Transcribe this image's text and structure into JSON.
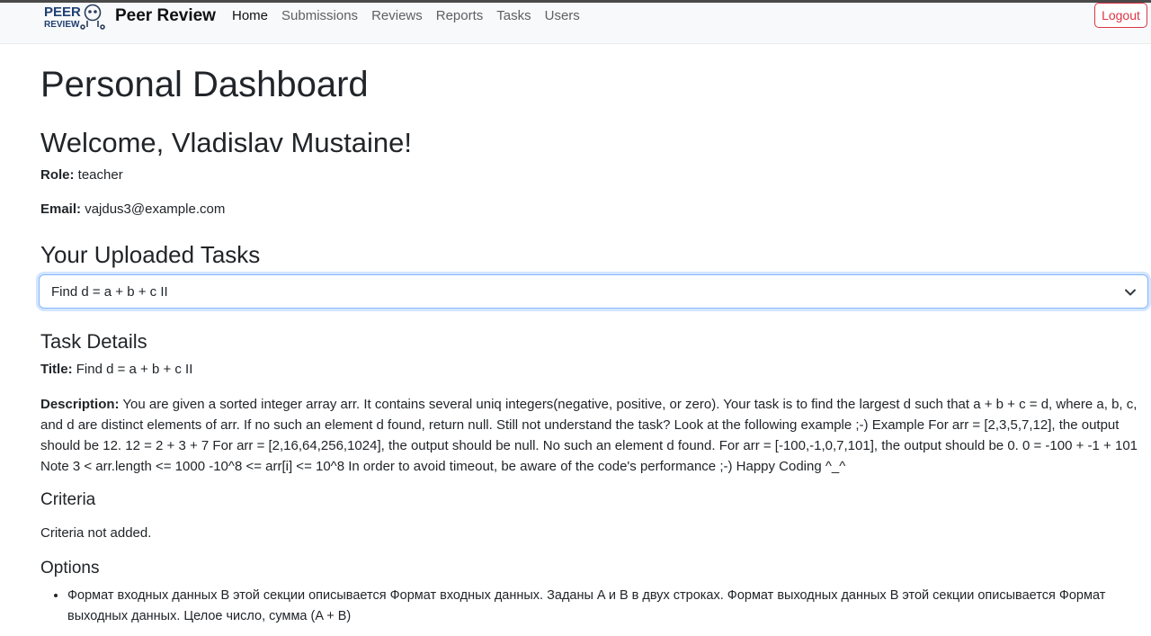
{
  "navbar": {
    "logo_text_top": "PEER",
    "logo_text_bottom": "REVIEW",
    "brand": "Peer Review",
    "links": [
      {
        "label": "Home",
        "active": true
      },
      {
        "label": "Submissions",
        "active": false
      },
      {
        "label": "Reviews",
        "active": false
      },
      {
        "label": "Reports",
        "active": false
      },
      {
        "label": "Tasks",
        "active": false
      },
      {
        "label": "Users",
        "active": false
      }
    ],
    "logout_label": "Logout"
  },
  "page": {
    "title": "Personal Dashboard",
    "welcome": "Welcome, Vladislav Mustaine!",
    "role_label": "Role:",
    "role_value": "teacher",
    "email_label": "Email:",
    "email_value": "vajdus3@example.com"
  },
  "tasks": {
    "heading": "Your Uploaded Tasks",
    "selected": "Find d = a + b + c II"
  },
  "details": {
    "heading": "Task Details",
    "title_label": "Title:",
    "title_value": "Find d = a + b + c II",
    "description_label": "Description:",
    "description_value": "You are given a sorted integer array arr. It contains several uniq integers(negative, positive, or zero). Your task is to find the largest d such that a + b + c = d, where a, b, c, and d are distinct elements of arr. If no such an element d found, return null. Still not understand the task? Look at the following example ;-) Example For arr = [2,3,5,7,12], the output should be 12. 12 = 2 + 3 + 7 For arr = [2,16,64,256,1024], the output should be null. No such an element d found. For arr = [-100,-1,0,7,101], the output should be 0. 0 = -100 + -1 + 101 Note 3 < arr.length <= 1000 -10^8 <= arr[i] <= 10^8 In order to avoid timeout, be aware of the code's performance ;-) Happy Coding ^_^",
    "criteria_heading": "Criteria",
    "criteria_text": "Criteria not added.",
    "options_heading": "Options",
    "options": [
      "Формат входных данных В этой секции описывается Формат входных данных. Заданы A и B в двух строках. Формат выходных данных В этой секции описывается Формат выходных данных. Целое число, сумма (A + B)"
    ]
  },
  "colors": {
    "accent": "#0d6efd",
    "danger": "#dc3545",
    "navbar_bg": "#f8f9fa",
    "logo_blue": "#1f3f73"
  },
  "icons": {
    "logo": "peer-review-logo-icon",
    "select_chevron": "chevron-down-icon"
  }
}
